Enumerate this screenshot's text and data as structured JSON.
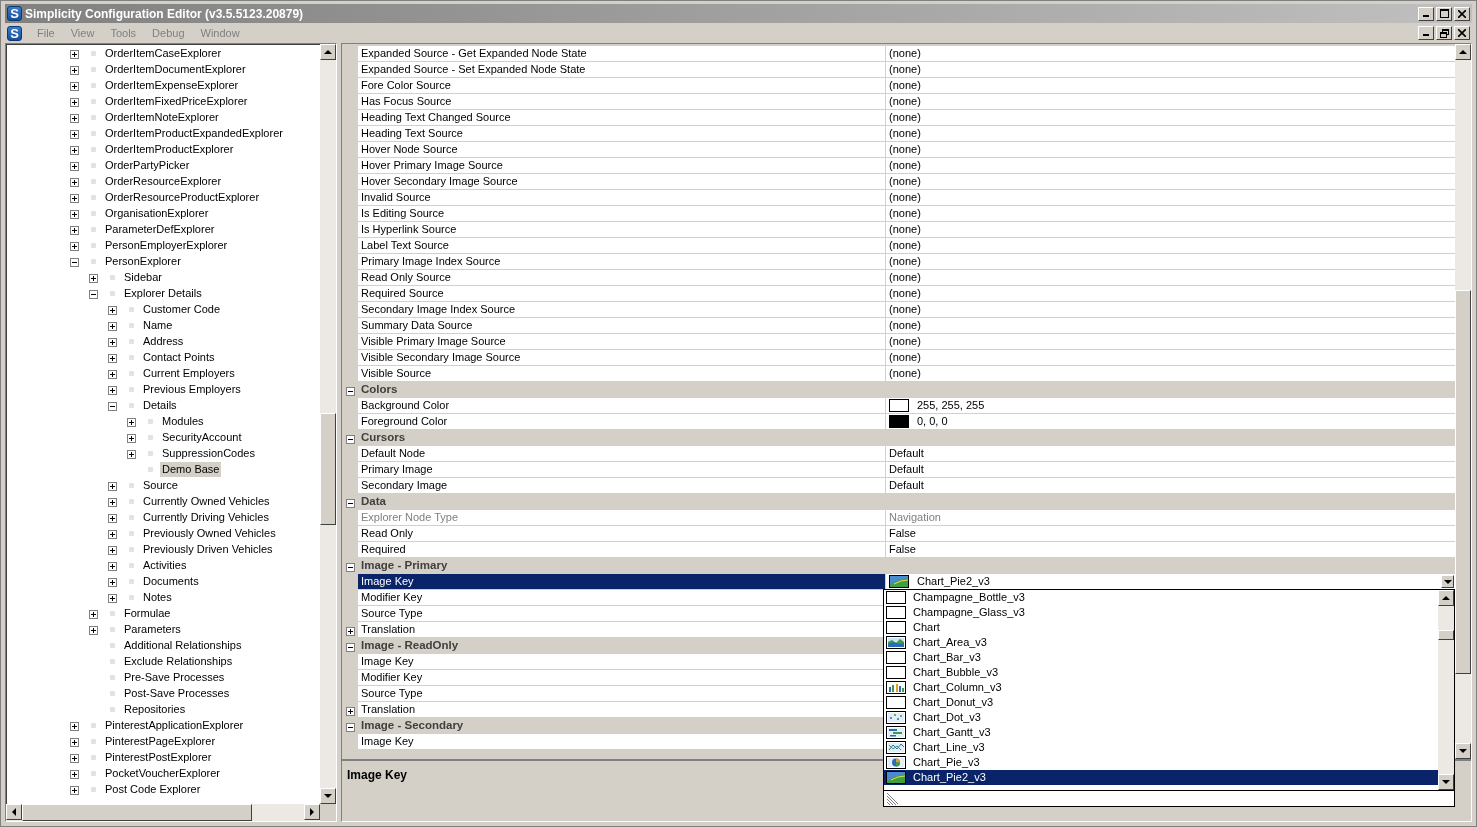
{
  "window": {
    "icon_letter": "S",
    "title": "Simplicity Configuration Editor (v3.5.5123.20879)"
  },
  "menu_bar": {
    "icon_letter": "S",
    "items": [
      "File",
      "View",
      "Tools",
      "Debug",
      "Window"
    ]
  },
  "tree": {
    "items": [
      {
        "label": "OrderItemCaseExplorer",
        "expanded": false,
        "selected": false
      },
      {
        "label": "OrderItemDocumentExplorer",
        "expanded": false,
        "selected": false
      },
      {
        "label": "OrderItemExpenseExplorer",
        "expanded": false,
        "selected": false
      },
      {
        "label": "OrderItemFixedPriceExplorer",
        "expanded": false,
        "selected": false
      },
      {
        "label": "OrderItemNoteExplorer",
        "expanded": false,
        "selected": false
      },
      {
        "label": "OrderItemProductExpandedExplorer",
        "expanded": false,
        "selected": false
      },
      {
        "label": "OrderItemProductExplorer",
        "expanded": false,
        "selected": false
      },
      {
        "label": "OrderPartyPicker",
        "expanded": false,
        "selected": false
      },
      {
        "label": "OrderResourceExplorer",
        "expanded": false,
        "selected": false
      },
      {
        "label": "OrderResourceProductExplorer",
        "expanded": false,
        "selected": false
      },
      {
        "label": "OrganisationExplorer",
        "expanded": false,
        "selected": false
      },
      {
        "label": "ParameterDefExplorer",
        "expanded": false,
        "selected": false
      },
      {
        "label": "PersonEmployerExplorer",
        "expanded": false,
        "selected": false
      },
      {
        "label": "PersonExplorer",
        "expanded": true,
        "selected": false,
        "children": [
          {
            "label": "Sidebar",
            "expanded": false,
            "selected": false
          },
          {
            "label": "Explorer Details",
            "expanded": true,
            "selected": false,
            "children": [
              {
                "label": "Customer Code",
                "expanded": false,
                "selected": false
              },
              {
                "label": "Name",
                "expanded": false,
                "selected": false
              },
              {
                "label": "Address",
                "expanded": false,
                "selected": false
              },
              {
                "label": "Contact Points",
                "expanded": false,
                "selected": false
              },
              {
                "label": "Current Employers",
                "expanded": false,
                "selected": false
              },
              {
                "label": "Previous Employers",
                "expanded": false,
                "selected": false
              },
              {
                "label": "Details",
                "expanded": true,
                "selected": false,
                "children": [
                  {
                    "label": "Modules",
                    "expanded": false,
                    "selected": false
                  },
                  {
                    "label": "SecurityAccount",
                    "expanded": false,
                    "selected": false
                  },
                  {
                    "label": "SuppressionCodes",
                    "expanded": false,
                    "selected": false
                  },
                  {
                    "label": "Demo Base",
                    "selected": true
                  }
                ]
              },
              {
                "label": "Source",
                "expanded": false,
                "selected": false
              },
              {
                "label": "Currently Owned Vehicles",
                "expanded": false,
                "selected": false
              },
              {
                "label": "Currently Driving Vehicles",
                "expanded": false,
                "selected": false
              },
              {
                "label": "Previously Owned Vehicles",
                "expanded": false,
                "selected": false
              },
              {
                "label": "Previously Driven Vehicles",
                "expanded": false,
                "selected": false
              },
              {
                "label": "Activities",
                "expanded": false,
                "selected": false
              },
              {
                "label": "Documents",
                "expanded": false,
                "selected": false
              },
              {
                "label": "Notes",
                "expanded": false,
                "selected": false
              }
            ]
          },
          {
            "label": "Formulae",
            "expanded": false,
            "selected": false
          },
          {
            "label": "Parameters",
            "expanded": false,
            "selected": false
          },
          {
            "label": "Additional Relationships",
            "selected": false
          },
          {
            "label": "Exclude Relationships",
            "selected": false
          },
          {
            "label": "Pre-Save Processes",
            "selected": false
          },
          {
            "label": "Post-Save Processes",
            "selected": false
          },
          {
            "label": "Repositories",
            "selected": false
          }
        ]
      },
      {
        "label": "PinterestApplicationExplorer",
        "expanded": false,
        "selected": false
      },
      {
        "label": "PinterestPageExplorer",
        "expanded": false,
        "selected": false
      },
      {
        "label": "PinterestPostExplorer",
        "expanded": false,
        "selected": false
      },
      {
        "label": "PocketVoucherExplorer",
        "expanded": false,
        "selected": false
      },
      {
        "label": "Post Code Explorer",
        "expanded": false,
        "selected": false
      }
    ]
  },
  "property_grid": {
    "groups": [
      {
        "properties": [
          {
            "name": "Expanded Source - Get Expanded Node State",
            "value": "(none)",
            "selected": false,
            "disabled": false
          },
          {
            "name": "Expanded Source - Set Expanded Node State",
            "value": "(none)",
            "selected": false,
            "disabled": false
          },
          {
            "name": "Fore Color Source",
            "value": "(none)",
            "selected": false,
            "disabled": false
          },
          {
            "name": "Has Focus Source",
            "value": "(none)",
            "selected": false,
            "disabled": false
          },
          {
            "name": "Heading Text Changed Source",
            "value": "(none)",
            "selected": false,
            "disabled": false
          },
          {
            "name": "Heading Text Source",
            "value": "(none)",
            "selected": false,
            "disabled": false
          },
          {
            "name": "Hover Node Source",
            "value": "(none)",
            "selected": false,
            "disabled": false
          },
          {
            "name": "Hover Primary Image Source",
            "value": "(none)",
            "selected": false,
            "disabled": false
          },
          {
            "name": "Hover Secondary Image Source",
            "value": "(none)",
            "selected": false,
            "disabled": false
          },
          {
            "name": "Invalid Source",
            "value": "(none)",
            "selected": false,
            "disabled": false
          },
          {
            "name": "Is Editing Source",
            "value": "(none)",
            "selected": false,
            "disabled": false
          },
          {
            "name": "Is Hyperlink Source",
            "value": "(none)",
            "selected": false,
            "disabled": false
          },
          {
            "name": "Label Text Source",
            "value": "(none)",
            "selected": false,
            "disabled": false
          },
          {
            "name": "Primary Image Index Source",
            "value": "(none)",
            "selected": false,
            "disabled": false
          },
          {
            "name": "Read Only Source",
            "value": "(none)",
            "selected": false,
            "disabled": false
          },
          {
            "name": "Required Source",
            "value": "(none)",
            "selected": false,
            "disabled": false
          },
          {
            "name": "Secondary Image Index Source",
            "value": "(none)",
            "selected": false,
            "disabled": false
          },
          {
            "name": "Summary Data Source",
            "value": "(none)",
            "selected": false,
            "disabled": false
          },
          {
            "name": "Visible Primary Image Source",
            "value": "(none)",
            "selected": false,
            "disabled": false
          },
          {
            "name": "Visible Secondary Image Source",
            "value": "(none)",
            "selected": false,
            "disabled": false
          },
          {
            "name": "Visible Source",
            "value": "(none)",
            "selected": false,
            "disabled": false
          }
        ]
      },
      {
        "title": "Colors",
        "expanded": true,
        "properties": [
          {
            "name": "Background Color",
            "value": "255, 255, 255",
            "kind": "color",
            "color": "#ffffff",
            "selected": false,
            "disabled": false
          },
          {
            "name": "Foreground Color",
            "value": "0, 0, 0",
            "kind": "color",
            "color": "#000000",
            "selected": false,
            "disabled": false
          }
        ]
      },
      {
        "title": "Cursors",
        "expanded": true,
        "properties": [
          {
            "name": "Default Node",
            "value": "Default",
            "selected": false,
            "disabled": false
          },
          {
            "name": "Primary Image",
            "value": "Default",
            "selected": false,
            "disabled": false
          },
          {
            "name": "Secondary Image",
            "value": "Default",
            "selected": false,
            "disabled": false
          }
        ]
      },
      {
        "title": "Data",
        "expanded": true,
        "properties": [
          {
            "name": "Explorer Node Type",
            "value": "Navigation",
            "selected": false,
            "disabled": true
          },
          {
            "name": "Read Only",
            "value": "False",
            "selected": false,
            "disabled": false
          },
          {
            "name": "Required",
            "value": "False",
            "selected": false,
            "disabled": false
          }
        ]
      },
      {
        "title": "Image - Primary",
        "expanded": true,
        "properties": [
          {
            "name": "Image Key",
            "value": "Chart_Pie2_v3",
            "kind": "image",
            "selected": true,
            "disabled": false
          },
          {
            "name": "Modifier Key",
            "selected": false,
            "disabled": false
          },
          {
            "name": "Source Type",
            "selected": false,
            "disabled": false
          },
          {
            "name": "Translation",
            "expanded": false,
            "selected": false,
            "disabled": false
          }
        ]
      },
      {
        "title": "Image - ReadOnly",
        "expanded": true,
        "properties": [
          {
            "name": "Image Key",
            "selected": false,
            "disabled": false
          },
          {
            "name": "Modifier Key",
            "selected": false,
            "disabled": false
          },
          {
            "name": "Source Type",
            "selected": false,
            "disabled": false
          },
          {
            "name": "Translation",
            "expanded": false,
            "selected": false,
            "disabled": false
          }
        ]
      },
      {
        "title": "Image - Secondary",
        "expanded": true,
        "properties": [
          {
            "name": "Image Key",
            "selected": false,
            "disabled": false
          }
        ]
      }
    ]
  },
  "dropdown": {
    "items": [
      {
        "label": "Champagne_Bottle_v3",
        "kind": "blank",
        "selected": false
      },
      {
        "label": "Champagne_Glass_v3",
        "kind": "blank",
        "selected": false
      },
      {
        "label": "Chart",
        "kind": "blank",
        "selected": false
      },
      {
        "label": "Chart_Area_v3",
        "kind": "area",
        "selected": false
      },
      {
        "label": "Chart_Bar_v3",
        "kind": "blank",
        "selected": false
      },
      {
        "label": "Chart_Bubble_v3",
        "kind": "blank",
        "selected": false
      },
      {
        "label": "Chart_Column_v3",
        "kind": "column",
        "selected": false
      },
      {
        "label": "Chart_Donut_v3",
        "kind": "blank",
        "selected": false
      },
      {
        "label": "Chart_Dot_v3",
        "kind": "dot",
        "selected": false
      },
      {
        "label": "Chart_Gantt_v3",
        "kind": "gantt",
        "selected": false
      },
      {
        "label": "Chart_Line_v3",
        "kind": "line",
        "selected": false
      },
      {
        "label": "Chart_Pie_v3",
        "kind": "pie",
        "selected": false
      },
      {
        "label": "Chart_Pie2_v3",
        "kind": "landscape",
        "selected": true
      }
    ]
  },
  "description": {
    "title": "Image Key"
  }
}
